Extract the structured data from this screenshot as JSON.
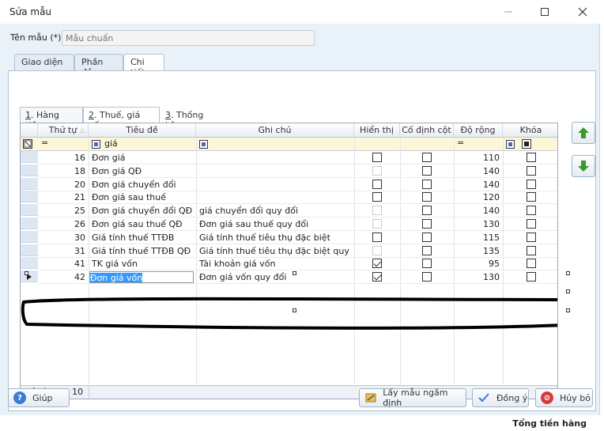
{
  "window": {
    "title": "Sửa mẫu",
    "minimize_icon": "minimize-icon",
    "maximize_icon": "maximize-icon",
    "close_icon": "close-icon"
  },
  "form": {
    "name_label": "Tên mẫu (*)",
    "name_placeholder": "Mẫu chuẩn"
  },
  "outer_tabs": [
    {
      "label": "Giao diện"
    },
    {
      "label": "Phần đầu"
    },
    {
      "label": "Chi tiết"
    }
  ],
  "inner_tabs": [
    {
      "num": "1",
      "label": ". Hàng tiền"
    },
    {
      "num": "2",
      "label": ". Thuế, giá vốn"
    },
    {
      "num": "3",
      "label": ". Thống kê"
    }
  ],
  "grid": {
    "columns": [
      "Thứ tự",
      "Tiêu đề",
      "Ghi chú",
      "Hiển thị",
      "Cố định cột",
      "Độ rộng",
      "Khóa"
    ],
    "filter": {
      "order_op": "=",
      "title_value": "giá",
      "width_op": "="
    },
    "rows": [
      {
        "order": "16",
        "title": "Đơn giá",
        "note": "",
        "show": "empty",
        "fixed": false,
        "width": "110",
        "lock": false
      },
      {
        "order": "18",
        "title": "Đơn giá QĐ",
        "note": "",
        "show": "disabled",
        "fixed": false,
        "width": "140",
        "lock": false
      },
      {
        "order": "20",
        "title": "Đơn giá chuyển đổi",
        "note": "",
        "show": "empty",
        "fixed": false,
        "width": "140",
        "lock": false
      },
      {
        "order": "21",
        "title": "Đơn giá sau thuế",
        "note": "",
        "show": "empty",
        "fixed": false,
        "width": "120",
        "lock": false
      },
      {
        "order": "25",
        "title": "Đơn giá chuyển đổi QĐ",
        "note": "giá chuyển đổi quy đổi",
        "show": "disabled",
        "fixed": false,
        "width": "140",
        "lock": false
      },
      {
        "order": "26",
        "title": "Đơn giá sau thuế QĐ",
        "note": "Đơn giá sau thuế quy đổi",
        "show": "disabled",
        "fixed": false,
        "width": "130",
        "lock": false
      },
      {
        "order": "30",
        "title": "Giá tính thuế TTĐB",
        "note": "Giá tính thuế tiêu thụ đặc biệt",
        "show": "empty",
        "fixed": false,
        "width": "115",
        "lock": false
      },
      {
        "order": "31",
        "title": "Giá tính thuế TTĐB QĐ",
        "note": "Giá tính thuế tiêu thụ đặc biệt quy đổi",
        "show": "disabled",
        "fixed": false,
        "width": "135",
        "lock": false
      },
      {
        "order": "41",
        "title": "TK giá vốn",
        "note": "Tài khoản giá vốn",
        "show": "checked",
        "fixed": false,
        "width": "95",
        "lock": false
      },
      {
        "order": "42",
        "title": "Đơn giá vốn",
        "note": "Đơn giá vốn quy đổi",
        "show": "checked",
        "fixed": false,
        "width": "130",
        "lock": false
      }
    ],
    "row_count": "Số dòng = 10"
  },
  "buttons": {
    "help": "Giúp",
    "default_template": "Lấy mẫu ngầm định",
    "ok": "Đồng ý",
    "cancel": "Hủy bỏ"
  },
  "status": {
    "total": "Tổng tiền hàng"
  }
}
